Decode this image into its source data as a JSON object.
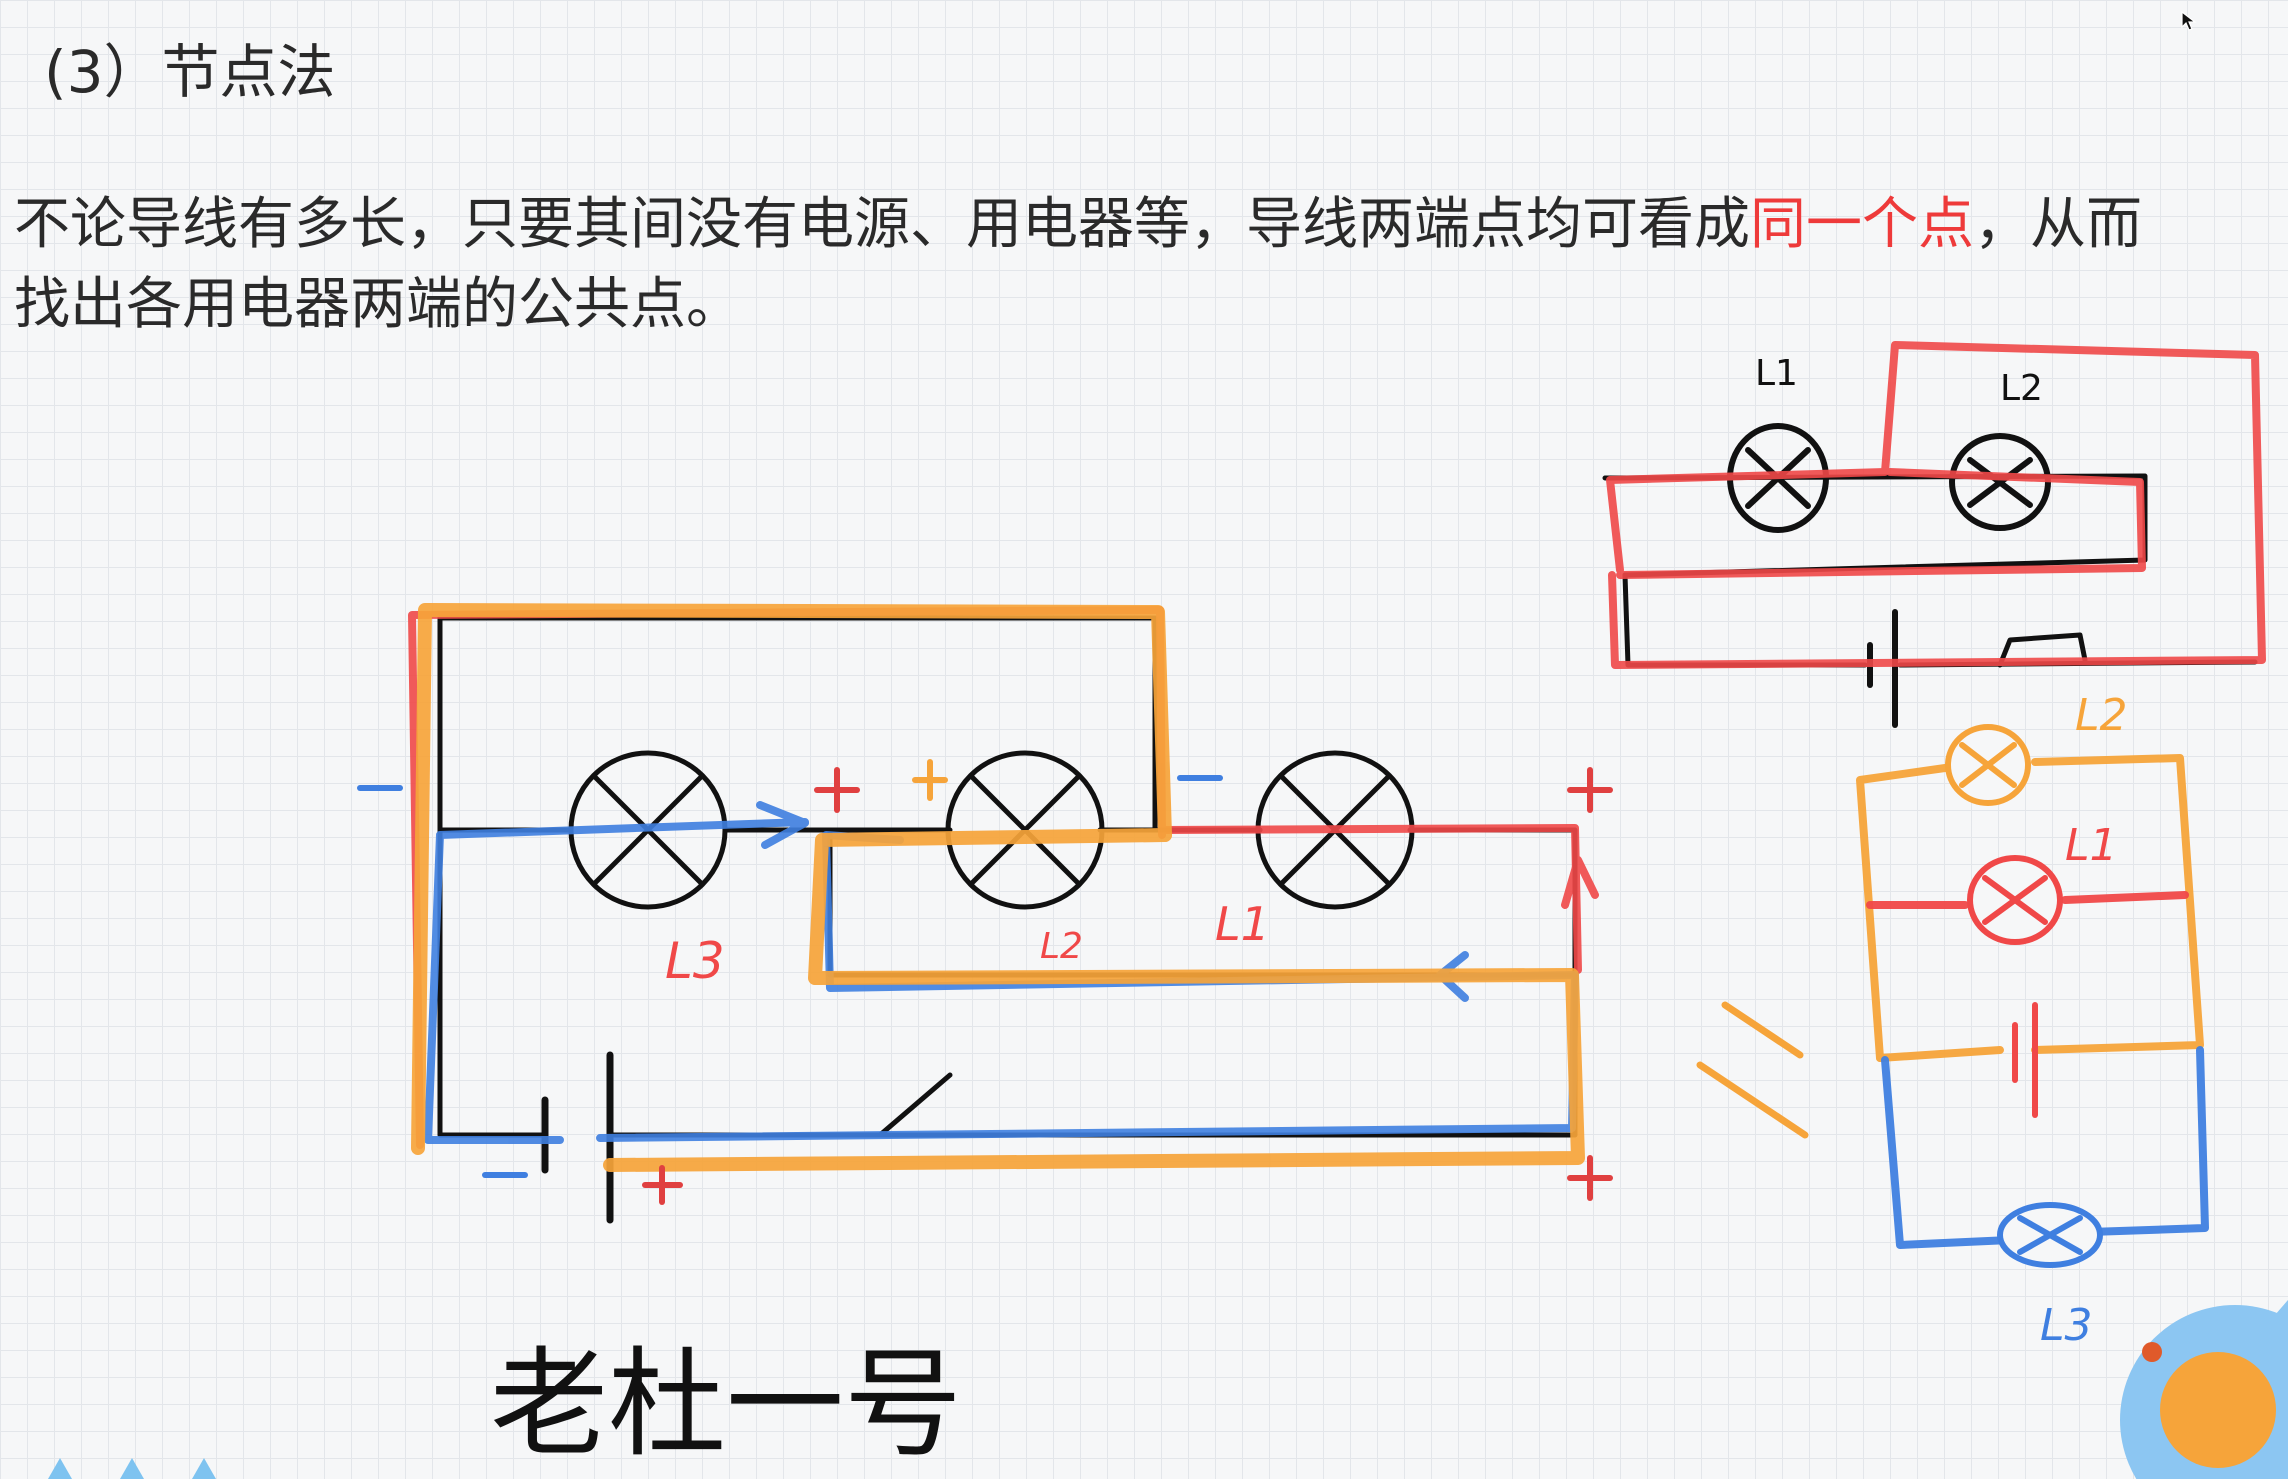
{
  "heading": "(3）节点法",
  "paragraph": {
    "line1_before": "不论导线有多长，只要其间没有电源、用电器等，导线两端点均可看成",
    "highlight": "同一个点",
    "line1_after": "，从而",
    "line2": "找出各用电器两端的公共点。"
  },
  "annotations": {
    "main_L3": "L3",
    "main_L2": "L2",
    "main_L1": "L1",
    "top_L1": "L1",
    "top_L2": "L2",
    "right_L2": "L2",
    "right_L1": "L1",
    "right_L3": "L3",
    "handwritten_name": "老杜一号",
    "plus": "+",
    "minus": "−"
  },
  "colors": {
    "text": "#2a2a2a",
    "highlight": "#ee3a3a",
    "wire_black": "#111111",
    "pen_red": "#f04848",
    "pen_orange": "#f6a43a",
    "pen_blue": "#3f7fe0",
    "grid": "#e3e6ea",
    "background": "#f6f7f8"
  }
}
